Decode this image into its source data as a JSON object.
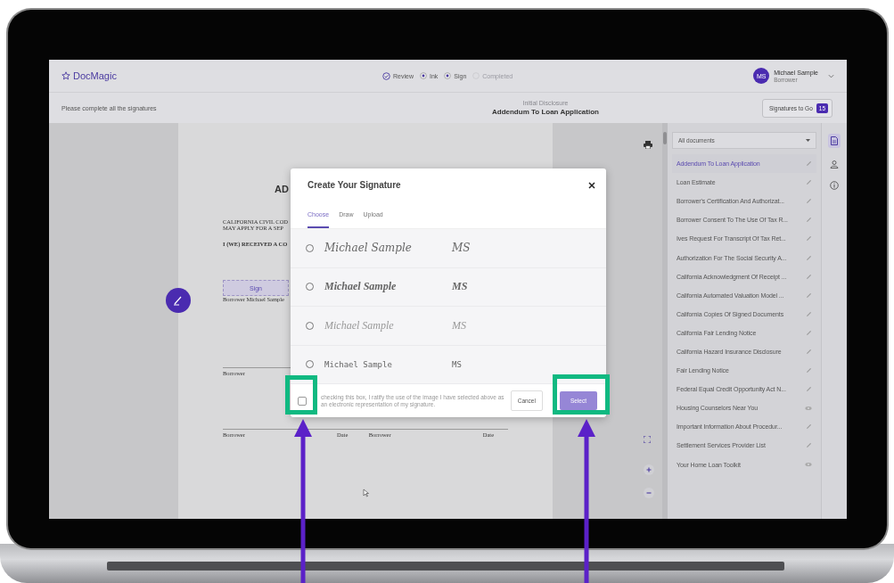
{
  "header": {
    "logo": "DocMagic",
    "steps": [
      {
        "label": "Review",
        "checked": true,
        "disabled": false
      },
      {
        "label": "Ink",
        "checked": false,
        "disabled": false
      },
      {
        "label": "Sign",
        "checked": false,
        "disabled": false
      },
      {
        "label": "Completed",
        "checked": false,
        "disabled": true
      }
    ],
    "user": {
      "initials": "MS",
      "name": "Michael Sample",
      "role": "Borrower"
    },
    "instruction": "Please complete all the signatures",
    "document_group": "Initial Disclosure",
    "document_title": "Addendum To Loan Application",
    "signatures_to_go": {
      "label": "Signatures to Go",
      "count": "15"
    }
  },
  "document": {
    "heading": "AD",
    "lines": [
      "CALIFORNIA CIVIL COD",
      "MAY APPLY FOR A SEP"
    ],
    "bold_line": "I (WE) RECEIVED A CO",
    "sign_button": "Sign",
    "signer": "Borrower Michael Sample",
    "borrower_label": "Borrower",
    "footer": [
      "Borrower",
      "Date",
      "Borrower",
      "Date"
    ]
  },
  "sidebar": {
    "filter": "All documents",
    "items": [
      {
        "label": "Addendum To Loan Application",
        "selected": true,
        "kind": "edit"
      },
      {
        "label": "Loan Estimate",
        "selected": false,
        "kind": "edit"
      },
      {
        "label": "Borrower's Certification And Authorizat...",
        "selected": false,
        "kind": "edit"
      },
      {
        "label": "Borrower Consent To The Use Of Tax R...",
        "selected": false,
        "kind": "edit"
      },
      {
        "label": "Ives Request For Transcript Of Tax Ret...",
        "selected": false,
        "kind": "edit"
      },
      {
        "label": "Authorization For The Social Security A...",
        "selected": false,
        "kind": "edit"
      },
      {
        "label": "California Acknowledgment Of Receipt ...",
        "selected": false,
        "kind": "edit"
      },
      {
        "label": "California Automated Valuation Model ...",
        "selected": false,
        "kind": "edit"
      },
      {
        "label": "California Copies Of Signed Documents",
        "selected": false,
        "kind": "edit"
      },
      {
        "label": "California Fair Lending Notice",
        "selected": false,
        "kind": "edit"
      },
      {
        "label": "California Hazard Insurance Disclosure",
        "selected": false,
        "kind": "edit"
      },
      {
        "label": "Fair Lending Notice",
        "selected": false,
        "kind": "edit"
      },
      {
        "label": "Federal Equal Credit Opportunity Act N...",
        "selected": false,
        "kind": "edit"
      },
      {
        "label": "Housing Counselors Near You",
        "selected": false,
        "kind": "view"
      },
      {
        "label": "Important Information About Procedur...",
        "selected": false,
        "kind": "edit"
      },
      {
        "label": "Settlement Services Provider List",
        "selected": false,
        "kind": "edit"
      },
      {
        "label": "Your Home Loan Toolkit",
        "selected": false,
        "kind": "view"
      }
    ]
  },
  "dialog": {
    "title": "Create Your Signature",
    "tabs": [
      {
        "label": "Choose",
        "selected": true
      },
      {
        "label": "Draw",
        "selected": false
      },
      {
        "label": "Upload",
        "selected": false
      }
    ],
    "options": [
      {
        "name": "Michael Sample",
        "initials": "MS",
        "kind": "slanted",
        "selected": false
      },
      {
        "name": "Michael Sample",
        "initials": "MS",
        "kind": "bold",
        "selected": false
      },
      {
        "name": "Michael Sample",
        "initials": "MS",
        "kind": "light",
        "selected": false
      },
      {
        "name": "Michael Sample",
        "initials": "MS",
        "kind": "print",
        "selected": false
      }
    ],
    "consent": {
      "text": "checking this box, I ratify the use of the image I have selected above as an electronic representation of my signature.",
      "checked": false
    },
    "cancel": "Cancel",
    "select": {
      "label": "Select",
      "disabled": true
    }
  }
}
